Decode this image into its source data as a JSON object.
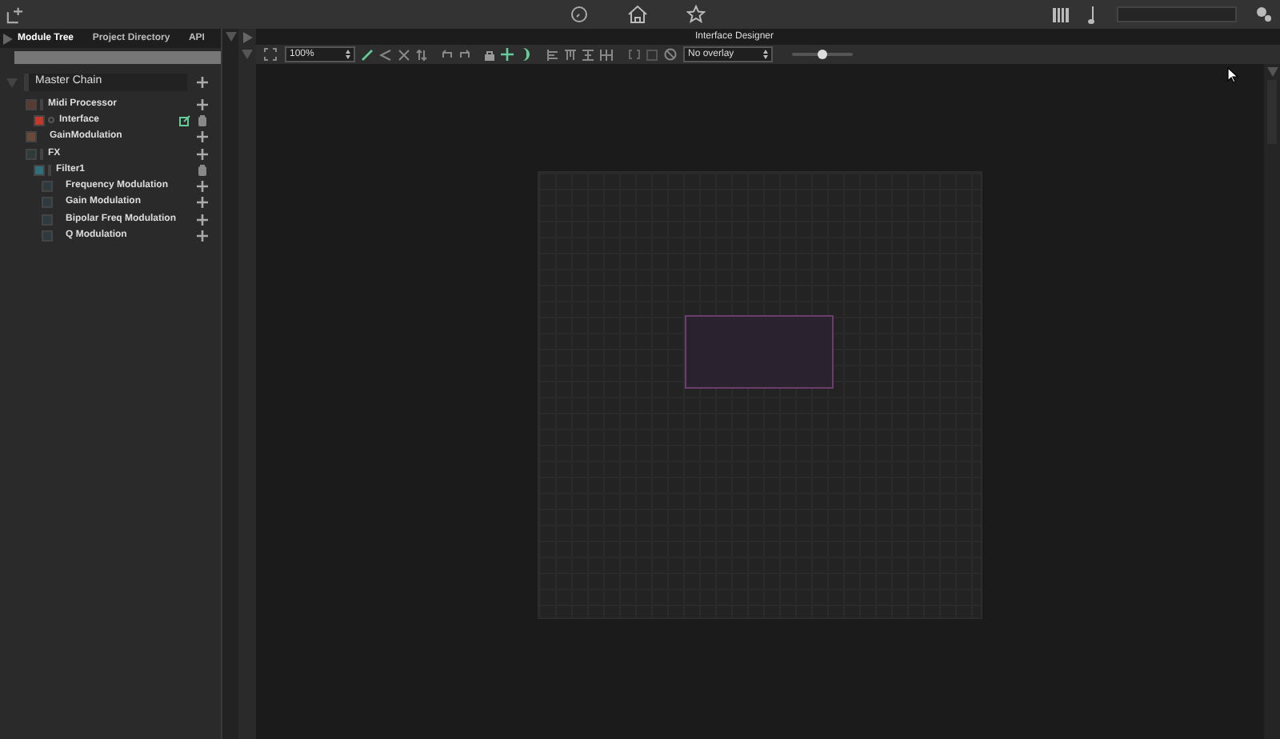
{
  "left_tabs": [
    {
      "label": "Module Tree",
      "selected": true
    },
    {
      "label": "Project Directory",
      "selected": false
    },
    {
      "label": "API",
      "selected": false
    }
  ],
  "tree": {
    "label": "Master Chain",
    "expanded": true,
    "children": [
      {
        "label": "Midi Processor",
        "color": "#5a3a32",
        "kind": "addable",
        "children": [
          {
            "label": "Interface",
            "color": "#c0392b",
            "kind": "removable",
            "open_editor": true
          }
        ]
      },
      {
        "label": "GainModulation",
        "color": "#6b4a3a",
        "kind": "addable"
      },
      {
        "label": "FX",
        "color": "#2f3a3a",
        "kind": "addable",
        "children": [
          {
            "label": "Filter1",
            "color": "#2f6f7a",
            "kind": "removable",
            "children": [
              {
                "label": "Frequency Modulation",
                "color": "#2e3a40",
                "kind": "addable"
              },
              {
                "label": "Gain Modulation",
                "color": "#2e3a40",
                "kind": "addable"
              },
              {
                "label": "Bipolar Freq Modulation",
                "color": "#2e3a40",
                "kind": "addable"
              },
              {
                "label": "Q Modulation",
                "color": "#2e3a40",
                "kind": "addable"
              }
            ]
          }
        ]
      }
    ]
  },
  "designer": {
    "title": "Interface Designer",
    "zoom": "100%",
    "overlay": "No overlay",
    "slider": {
      "level": 0.5
    }
  }
}
